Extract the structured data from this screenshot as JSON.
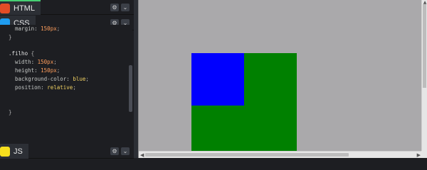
{
  "panes": {
    "html": {
      "label": "HTML",
      "icon": "html-icon",
      "icon_color": "#e34c26"
    },
    "css": {
      "label": "CSS",
      "icon": "css-icon",
      "icon_color": "#1f9cf0"
    },
    "js": {
      "label": "JS",
      "icon": "js-icon",
      "icon_color": "#f7df1e"
    }
  },
  "controls": {
    "settings_glyph": "⚙",
    "collapse_glyph": "⌄"
  },
  "css_code": [
    [
      {
        "t": "prop",
        "v": "  margin: "
      },
      {
        "t": "num",
        "v": "150px"
      },
      {
        "t": "punc",
        "v": ";"
      }
    ],
    [
      {
        "t": "punc",
        "v": "}"
      }
    ],
    [],
    [
      {
        "t": "sel",
        "v": ".filho"
      },
      {
        "t": "punc",
        "v": " {"
      }
    ],
    [
      {
        "t": "prop",
        "v": "  width: "
      },
      {
        "t": "num",
        "v": "150px"
      },
      {
        "t": "punc",
        "v": ";"
      }
    ],
    [
      {
        "t": "prop",
        "v": "  height: "
      },
      {
        "t": "num",
        "v": "150px"
      },
      {
        "t": "punc",
        "v": ";"
      }
    ],
    [
      {
        "t": "prop",
        "v": "  background-color: "
      },
      {
        "t": "val",
        "v": "blue"
      },
      {
        "t": "punc",
        "v": ";"
      }
    ],
    [
      {
        "t": "prop",
        "v": "  position: "
      },
      {
        "t": "val",
        "v": "relative"
      },
      {
        "t": "punc",
        "v": ";"
      }
    ],
    [],
    [],
    [
      {
        "t": "punc",
        "v": "}"
      }
    ]
  ],
  "preview": {
    "background": "#aaa9ab",
    "parent_color": "#008000",
    "child_color": "#0000ff"
  },
  "scroll_arrows": {
    "up": "▲",
    "left": "◀",
    "right": "▶"
  }
}
